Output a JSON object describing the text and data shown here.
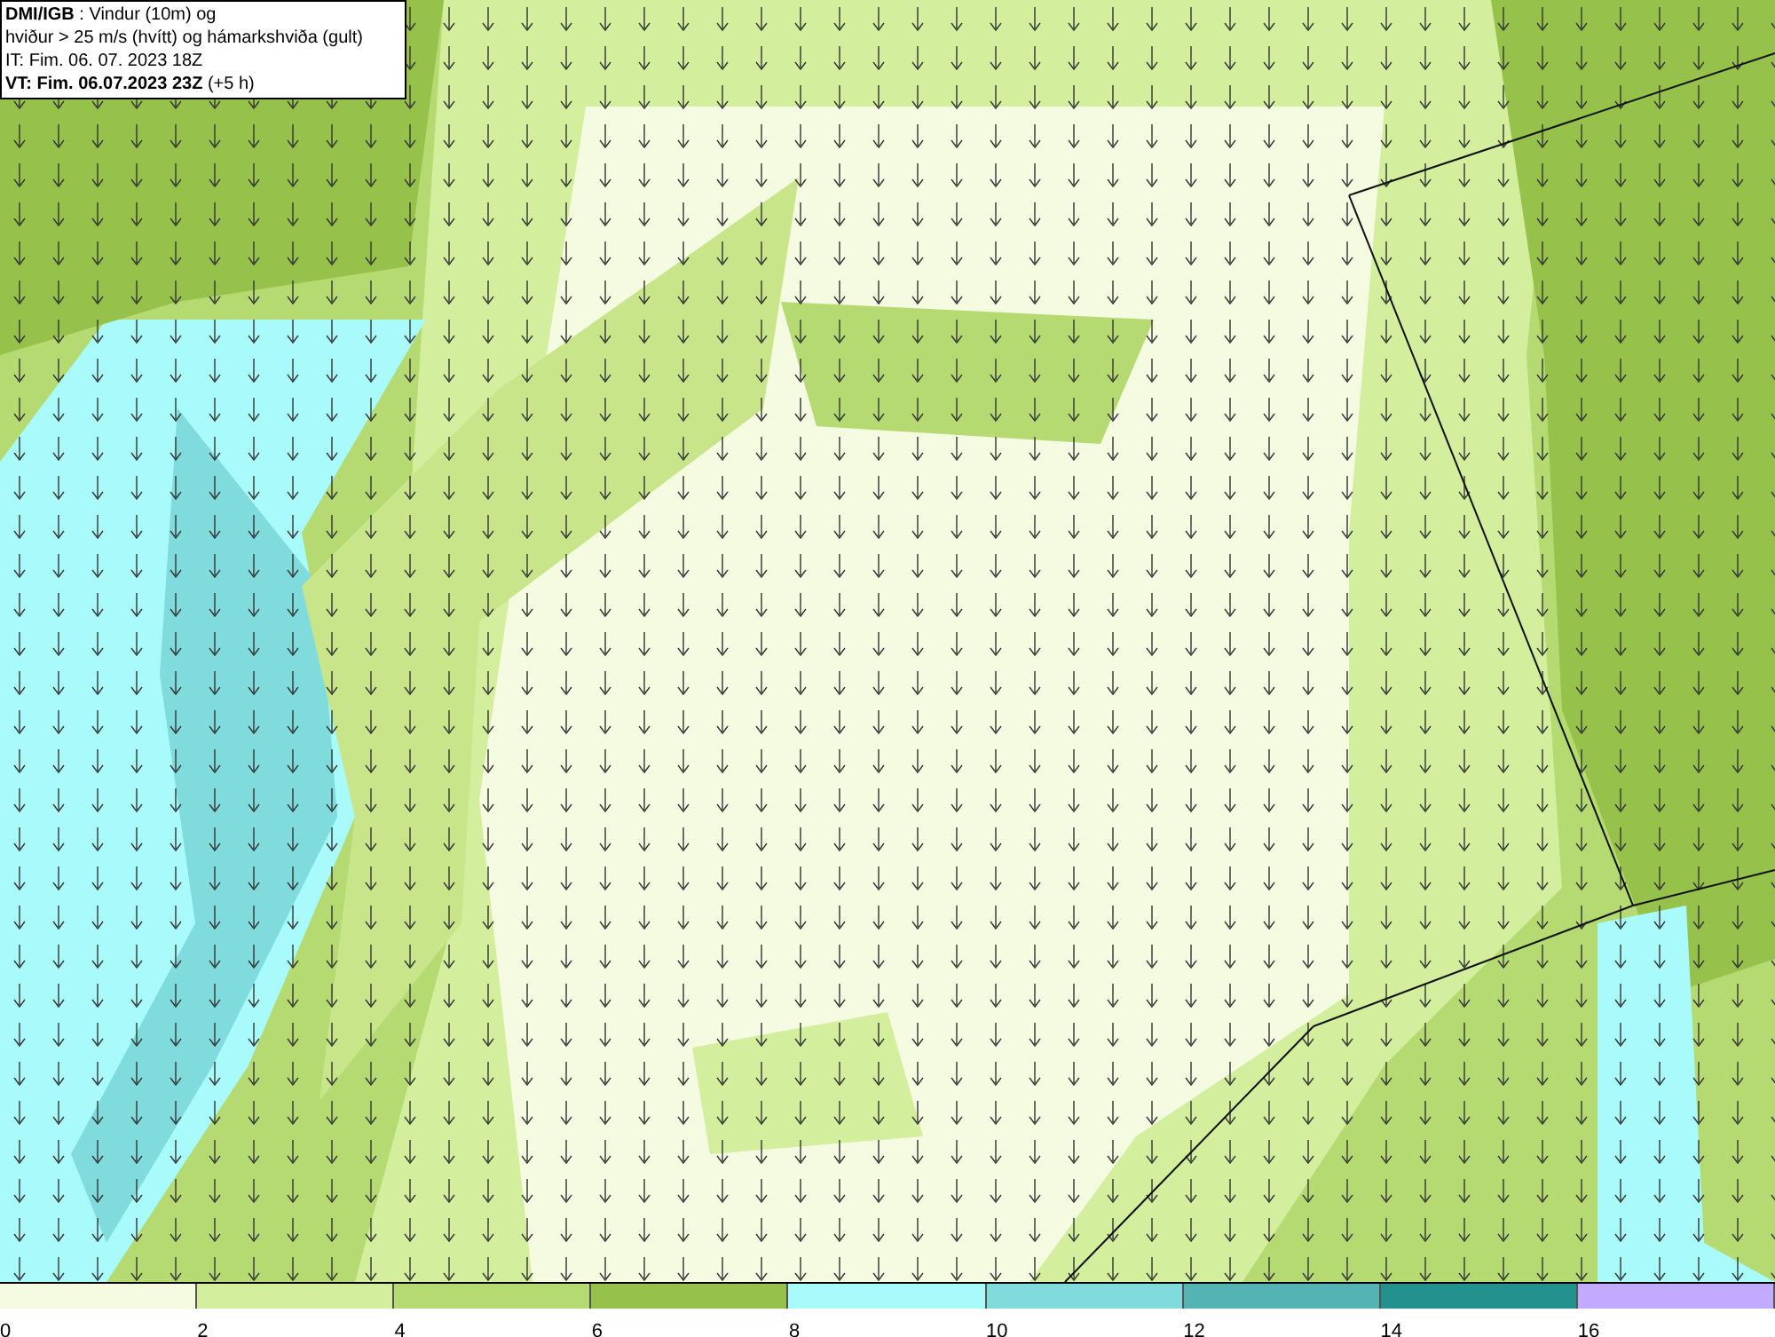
{
  "header": {
    "lines": [
      "**DMI/IGB** : Vindur (10m) og",
      "hviður > 25 m/s (hvítt) og hámarkshviða (gult)",
      "IT: Fim. 06. 07. 2023 18Z",
      "**VT: Fim. 06.07.2023 23Z** (+5 h)"
    ]
  },
  "legend": {
    "segments": [
      {
        "color": "#f4fbe0"
      },
      {
        "color": "#d3ee9d"
      },
      {
        "color": "#b5da72"
      },
      {
        "color": "#96c14a"
      },
      {
        "color": "#a9fafa"
      },
      {
        "color": "#80dcdc"
      },
      {
        "color": "#54b4b4"
      },
      {
        "color": "#23918d"
      },
      {
        "color": "#c2aaff"
      }
    ],
    "ticks": [
      "0",
      "2",
      "4",
      "6",
      "8",
      "10",
      "12",
      "14",
      "16"
    ]
  }
}
